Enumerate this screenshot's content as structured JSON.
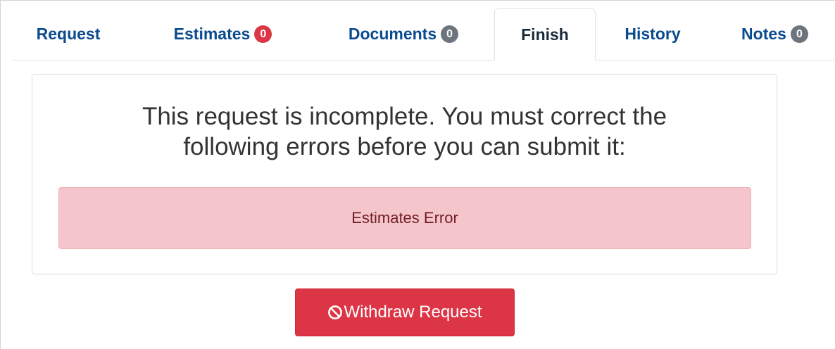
{
  "tabs": [
    {
      "label": "Request",
      "badge": null,
      "active": false
    },
    {
      "label": "Estimates",
      "badge": "0",
      "badge_color": "#dc3545",
      "active": false
    },
    {
      "label": "Documents",
      "badge": "0",
      "badge_color": "#6c757d",
      "active": false
    },
    {
      "label": "Finish",
      "badge": null,
      "active": true
    },
    {
      "label": "History",
      "badge": null,
      "active": false
    },
    {
      "label": "Notes",
      "badge": "0",
      "badge_color": "#6c757d",
      "active": false
    }
  ],
  "finish": {
    "message_line1": "This request is incomplete. You must correct the",
    "message_line2": "following errors before you can submit it:",
    "errors": [
      "Estimates Error"
    ]
  },
  "actions": {
    "withdraw_label": "Withdraw Request",
    "withdraw_icon": "ban-icon",
    "withdraw_color": "#dc3545"
  },
  "colors": {
    "tab_link": "#0a4a8f",
    "alert_bg": "#f4c5ca",
    "alert_text": "#721c24"
  }
}
